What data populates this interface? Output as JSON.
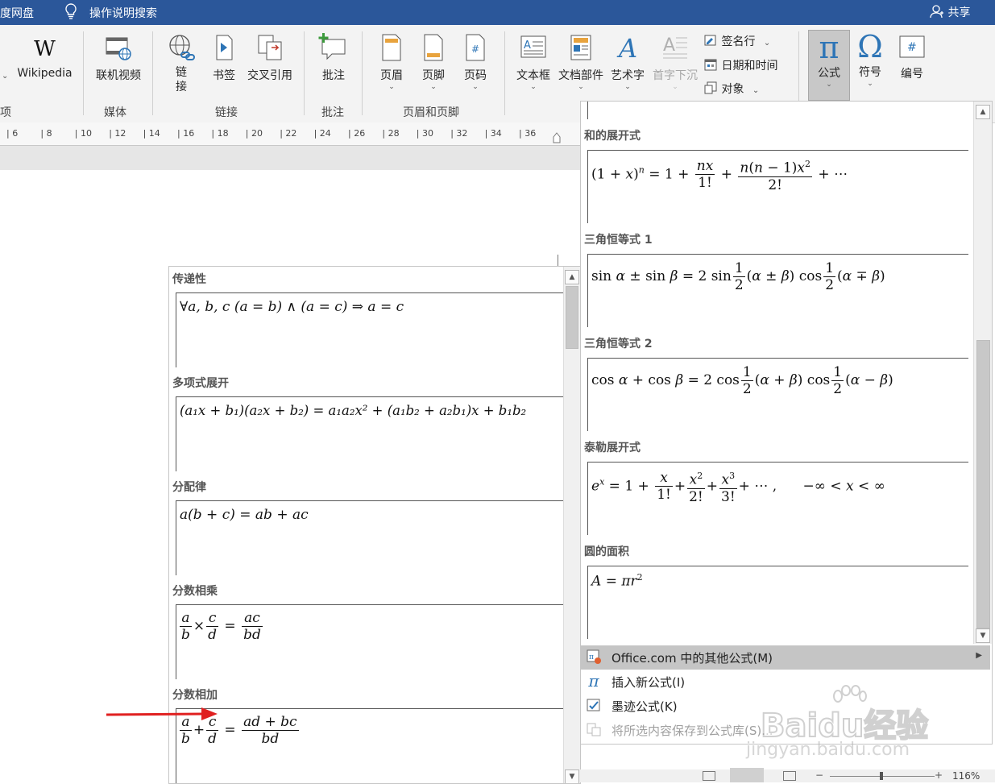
{
  "titlebar": {
    "baidu_label": "度网盘",
    "tell_me": "操作说明搜索",
    "share": "共享"
  },
  "ribbon": {
    "buttons": {
      "wikipedia": "Wikipedia",
      "online_video": "联机视频",
      "link_1": "链",
      "link_2": "接",
      "bookmark": "书签",
      "cross_ref": "交叉引用",
      "comment": "批注",
      "header": "页眉",
      "footer": "页脚",
      "page_number": "页码",
      "text_box": "文本框",
      "quick_parts": "文档部件",
      "wordart": "艺术字",
      "drop_cap": "首字下沉",
      "signature_line": "签名行",
      "date_time": "日期和时间",
      "object": "对象",
      "equation": "公式",
      "symbol": "符号",
      "number": "编号"
    },
    "groups": {
      "partial": "项",
      "media": "媒体",
      "links": "链接",
      "comments": "批注",
      "header_footer": "页眉和页脚"
    }
  },
  "ruler": [
    "6",
    "8",
    "10",
    "12",
    "14",
    "16",
    "18",
    "20",
    "22",
    "24",
    "26",
    "28",
    "30",
    "32",
    "34",
    "36"
  ],
  "left_gallery": {
    "sections": [
      {
        "title": "传递性",
        "eq": "∀a, b, c (a = b) ∧ (a = c)  ⇒ a = c"
      },
      {
        "title": "多项式展开",
        "eq": "(a₁x + b₁)(a₂x + b₂) = a₁a₂x² + (a₁b₂ + a₂b₁)x + b₁b₂"
      },
      {
        "title": "分配律",
        "eq": "a(b + c) = ab + ac"
      },
      {
        "title": "分数相乘"
      },
      {
        "title": "分数相加"
      }
    ]
  },
  "right_gallery": {
    "sections": [
      {
        "title": "和的展开式"
      },
      {
        "title": "三角恒等式 1"
      },
      {
        "title": "三角恒等式 2"
      },
      {
        "title": "泰勒展开式"
      },
      {
        "title": "圆的面积"
      }
    ]
  },
  "menu": {
    "more_equations": "Office.com 中的其他公式(M)",
    "insert_new": "插入新公式(I)",
    "ink_equation": "墨迹公式(K)",
    "save_selection": "将所选内容保存到公式库(S)..."
  },
  "status": {
    "zoom": "116%"
  },
  "watermark": {
    "brand": "Baidu经验",
    "url": "jingyan.baidu.com"
  }
}
